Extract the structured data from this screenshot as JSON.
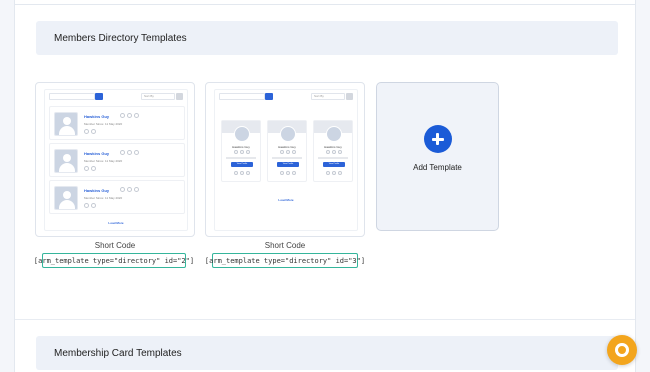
{
  "sections": {
    "members_directory": {
      "title": "Members Directory Templates"
    },
    "membership_card": {
      "title": "Membership Card Templates"
    }
  },
  "templates": [
    {
      "preview": {
        "sort_label": "Sort By",
        "rows": [
          {
            "name": "Hawkins Guy",
            "since": "Member Since: 11 May 2020"
          },
          {
            "name": "Hawkins Guy",
            "since": "Member Since: 11 May 2020"
          },
          {
            "name": "Hawkins Guy",
            "since": "Member Since: 11 May 2020"
          }
        ],
        "load_more": "Load More"
      },
      "shortcode_label": "Short Code",
      "shortcode": "[arm_template type=\"directory\" id=\"2\"]"
    },
    {
      "preview": {
        "sort_label": "Sort By",
        "cards": [
          {
            "name": "Hawkins Guy",
            "button": "View Profile"
          },
          {
            "name": "Hawkins Guy",
            "button": "View Profile"
          },
          {
            "name": "Hawkins Guy",
            "button": "View Profile"
          }
        ],
        "load_more": "Load More"
      },
      "shortcode_label": "Short Code",
      "shortcode": "[arm_template type=\"directory\" id=\"3\"]"
    }
  ],
  "add_template": {
    "label": "Add Template",
    "icon": "plus-circle-icon"
  },
  "help": {
    "icon": "lifebuoy-icon"
  },
  "colors": {
    "accent": "#1b5bd7",
    "shortcode_border": "#35b59b",
    "help_button": "#f3a51d"
  }
}
